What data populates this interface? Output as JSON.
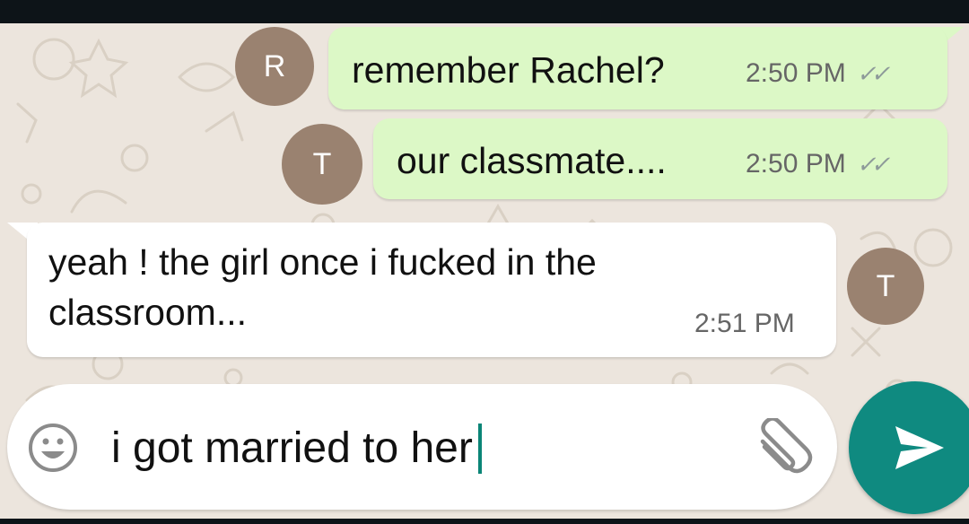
{
  "colors": {
    "outgoing_bubble": "#dcf8c6",
    "incoming_bubble": "#ffffff",
    "wallpaper": "#ece5dd",
    "avatar": "#9a8270",
    "send_button": "#0f8a80"
  },
  "messages": [
    {
      "text": "remember Rachel?",
      "time": "2:50 PM",
      "avatar_initial": "R",
      "direction": "outgoing",
      "status_icon": "double-check-icon"
    },
    {
      "text": "our classmate....",
      "time": "2:50 PM",
      "avatar_initial": "T",
      "direction": "outgoing",
      "status_icon": "double-check-icon"
    },
    {
      "text_lines": [
        "yeah ! the girl once i fucked in the",
        "classroom..."
      ],
      "time": "2:51 PM",
      "avatar_initial": "T",
      "direction": "incoming"
    }
  ],
  "composer": {
    "text": "i got married to her",
    "emoji_icon": "emoji-icon",
    "attach_icon": "paperclip-icon",
    "send_icon": "send-icon"
  }
}
